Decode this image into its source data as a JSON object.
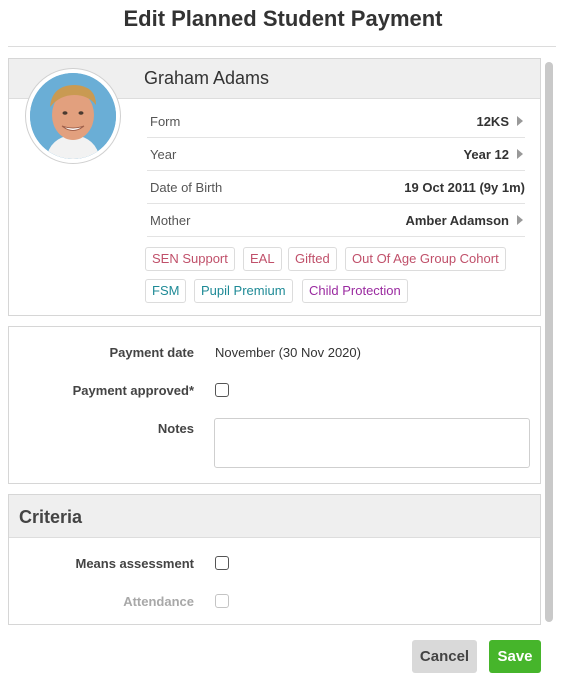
{
  "dialog": {
    "title": "Edit Planned Student Payment"
  },
  "student": {
    "name": "Graham Adams",
    "avatar_icon": "student-photo",
    "rows": [
      {
        "label": "Form",
        "value": "12KS",
        "has_arrow": true
      },
      {
        "label": "Year",
        "value": "Year 12",
        "has_arrow": true
      },
      {
        "label": "Date of Birth",
        "value": "19 Oct 2011 (9y 1m)",
        "has_arrow": false
      },
      {
        "label": "Mother",
        "value": "Amber Adamson",
        "has_arrow": true
      }
    ],
    "tags": [
      {
        "label": "SEN Support",
        "color": "#c0506a"
      },
      {
        "label": "EAL",
        "color": "#c0506a"
      },
      {
        "label": "Gifted",
        "color": "#c0506a"
      },
      {
        "label": "Out Of Age Group Cohort",
        "color": "#c0506a"
      },
      {
        "label": "FSM",
        "color": "#1e8a96"
      },
      {
        "label": "Pupil Premium",
        "color": "#1e8a96"
      },
      {
        "label": "Child Protection",
        "color": "#9a2aa0"
      }
    ]
  },
  "payment": {
    "date_label": "Payment date",
    "date_value": "November (30 Nov 2020)",
    "approved_label": "Payment approved*",
    "approved_checked": false,
    "notes_label": "Notes",
    "notes_value": ""
  },
  "criteria": {
    "title": "Criteria",
    "means_label": "Means assessment",
    "means_checked": false,
    "attendance_label": "Attendance",
    "attendance_checked": false,
    "attendance_disabled": true
  },
  "buttons": {
    "cancel": "Cancel",
    "save": "Save"
  },
  "colors": {
    "save": "#46b52b",
    "cancel": "#d9d9d9"
  }
}
